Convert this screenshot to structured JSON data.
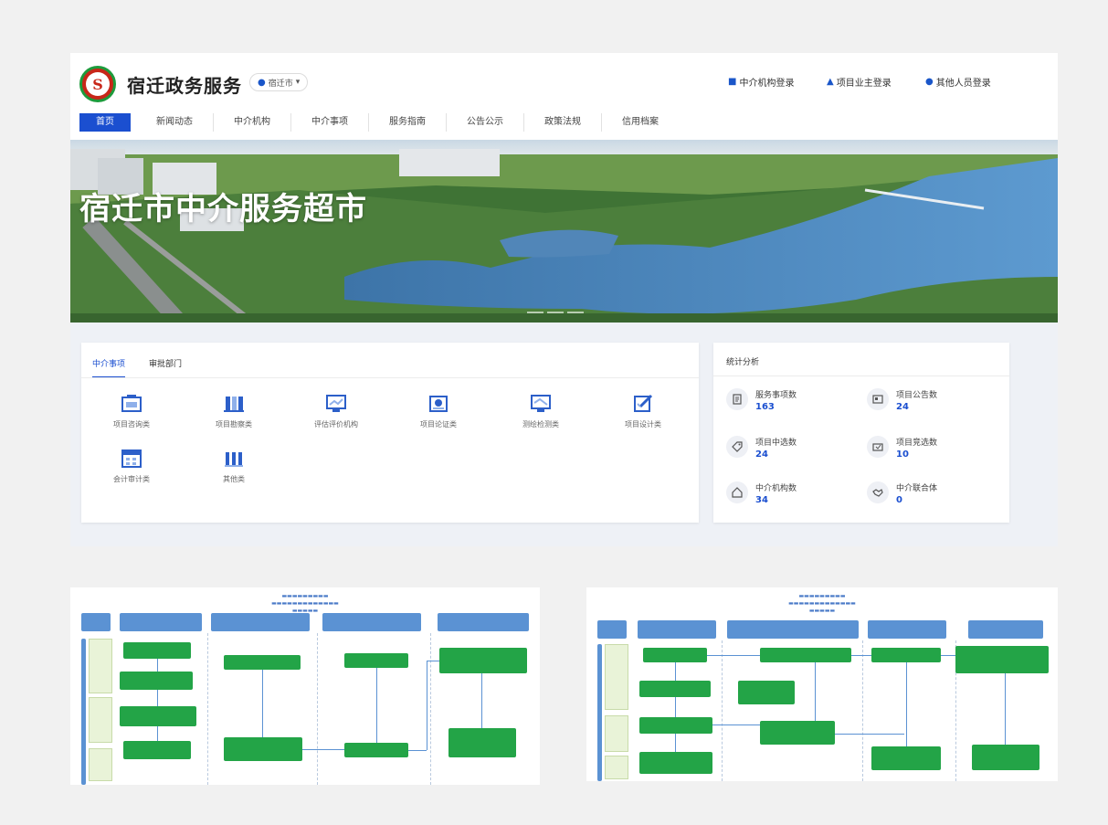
{
  "header": {
    "site_title": "宿迁政务服务",
    "city": "宿迁市",
    "logins": [
      {
        "label": "中介机构登录",
        "icon": "building-icon"
      },
      {
        "label": "项目业主登录",
        "icon": "person-icon"
      },
      {
        "label": "其他人员登录",
        "icon": "user-circle-icon"
      }
    ]
  },
  "nav": {
    "items": [
      "首页",
      "新闻动态",
      "中介机构",
      "中介事项",
      "服务指南",
      "公告公示",
      "政策法规",
      "信用档案"
    ],
    "active": "首页"
  },
  "banner": {
    "title": "宿迁市中介服务超市"
  },
  "categories_panel": {
    "tabs": [
      "中介事项",
      "审批部门"
    ],
    "active_tab": "中介事项",
    "items": [
      {
        "label": "项目咨询类",
        "icon": "consult-icon"
      },
      {
        "label": "项目勘察类",
        "icon": "survey-icon"
      },
      {
        "label": "评估评价机构",
        "icon": "evaluate-icon"
      },
      {
        "label": "项目论证类",
        "icon": "demonstrate-icon"
      },
      {
        "label": "测绘检测类",
        "icon": "mapping-icon"
      },
      {
        "label": "项目设计类",
        "icon": "design-icon"
      },
      {
        "label": "会计审计类",
        "icon": "audit-icon"
      },
      {
        "label": "其他类",
        "icon": "other-icon"
      }
    ]
  },
  "stats_panel": {
    "title": "统计分析",
    "items": [
      {
        "label": "服务事项数",
        "value": "163",
        "icon": "document-icon"
      },
      {
        "label": "项目公告数",
        "value": "24",
        "icon": "notice-icon"
      },
      {
        "label": "项目中选数",
        "value": "24",
        "icon": "tag-icon"
      },
      {
        "label": "项目竞选数",
        "value": "10",
        "icon": "vote-icon"
      },
      {
        "label": "中介机构数",
        "value": "34",
        "icon": "home-icon"
      },
      {
        "label": "中介联合体",
        "value": "0",
        "icon": "handshake-icon"
      }
    ]
  },
  "colors": {
    "brand_blue": "#1b4fd0",
    "flow_blue": "#5b92d3",
    "flow_green": "#23a447"
  }
}
